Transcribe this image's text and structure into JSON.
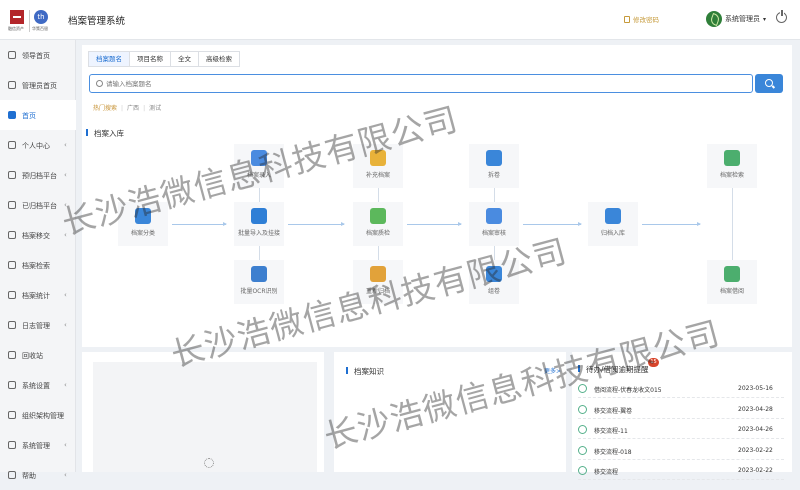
{
  "header": {
    "logo_text_1": "融信资产",
    "logo_text_2": "华策百银",
    "logo_mark": "th",
    "app_title": "档案管理系统",
    "change_password": "修改密码",
    "user_name": "系统管理员"
  },
  "sidebar": {
    "items": [
      {
        "label": "领导首页",
        "icon": "dashboard-icon",
        "arrow": ""
      },
      {
        "label": "管理员首页",
        "icon": "user-icon",
        "arrow": ""
      },
      {
        "label": "首页",
        "icon": "home-icon",
        "arrow": "",
        "active": true
      },
      {
        "label": "个人中心",
        "icon": "person-icon",
        "arrow": "‹"
      },
      {
        "label": "预归档平台",
        "icon": "pre-archive-icon",
        "arrow": "‹"
      },
      {
        "label": "已归档平台",
        "icon": "archived-icon",
        "arrow": "‹"
      },
      {
        "label": "档案移交",
        "icon": "transfer-icon",
        "arrow": "‹"
      },
      {
        "label": "档案检索",
        "icon": "archive-search-icon",
        "arrow": ""
      },
      {
        "label": "档案统计",
        "icon": "statistics-icon",
        "arrow": "‹"
      },
      {
        "label": "日志管理",
        "icon": "log-icon",
        "arrow": "‹"
      },
      {
        "label": "回收站",
        "icon": "recycle-icon",
        "arrow": ""
      },
      {
        "label": "系统设置",
        "icon": "settings-icon",
        "arrow": "‹"
      },
      {
        "label": "组织架构管理",
        "icon": "org-icon",
        "arrow": ""
      },
      {
        "label": "系统管理",
        "icon": "system-icon",
        "arrow": "‹"
      },
      {
        "label": "帮助",
        "icon": "help-icon",
        "arrow": "‹"
      }
    ]
  },
  "search": {
    "tabs": [
      "档案题名",
      "项目名称",
      "全文",
      "高级检索"
    ],
    "placeholder": "请输入档案题名",
    "hot_label": "热门搜索",
    "hot_terms": [
      "广西",
      "测试"
    ]
  },
  "flow": {
    "title": "档案入库",
    "nodes": {
      "classify": "档案分类",
      "entry": "档案录入",
      "batch_import": "批量导入及挂接",
      "batch_ocr": "批量OCR识别",
      "supplement": "补充档案",
      "verify": "档案质检",
      "refile": "重新归档",
      "split": "拆卷",
      "review": "档案审核",
      "group": "组卷",
      "filing": "归档入库",
      "retrieve": "档案检索",
      "borrow": "档案借阅"
    }
  },
  "knowledge": {
    "title": "档案知识",
    "more": "更多>"
  },
  "todo": {
    "title": "待办/借阅逾期提醒",
    "badge": "15",
    "rows": [
      {
        "title": "借阅流程-伏春龙收文015",
        "date": "2023-05-16"
      },
      {
        "title": "移交流程-翼卷",
        "date": "2023-04-28"
      },
      {
        "title": "移交流程-11",
        "date": "2023-04-26"
      },
      {
        "title": "移交流程-018",
        "date": "2023-02-22"
      },
      {
        "title": "移交流程",
        "date": "2023-02-22"
      }
    ]
  },
  "watermark": {
    "text": "长沙浩微信息科技有限公司"
  },
  "colors": {
    "accent": "#1f6fd1",
    "brand_red": "#b3262a",
    "gold": "#c8953a",
    "todo_green": "#55b08b"
  }
}
